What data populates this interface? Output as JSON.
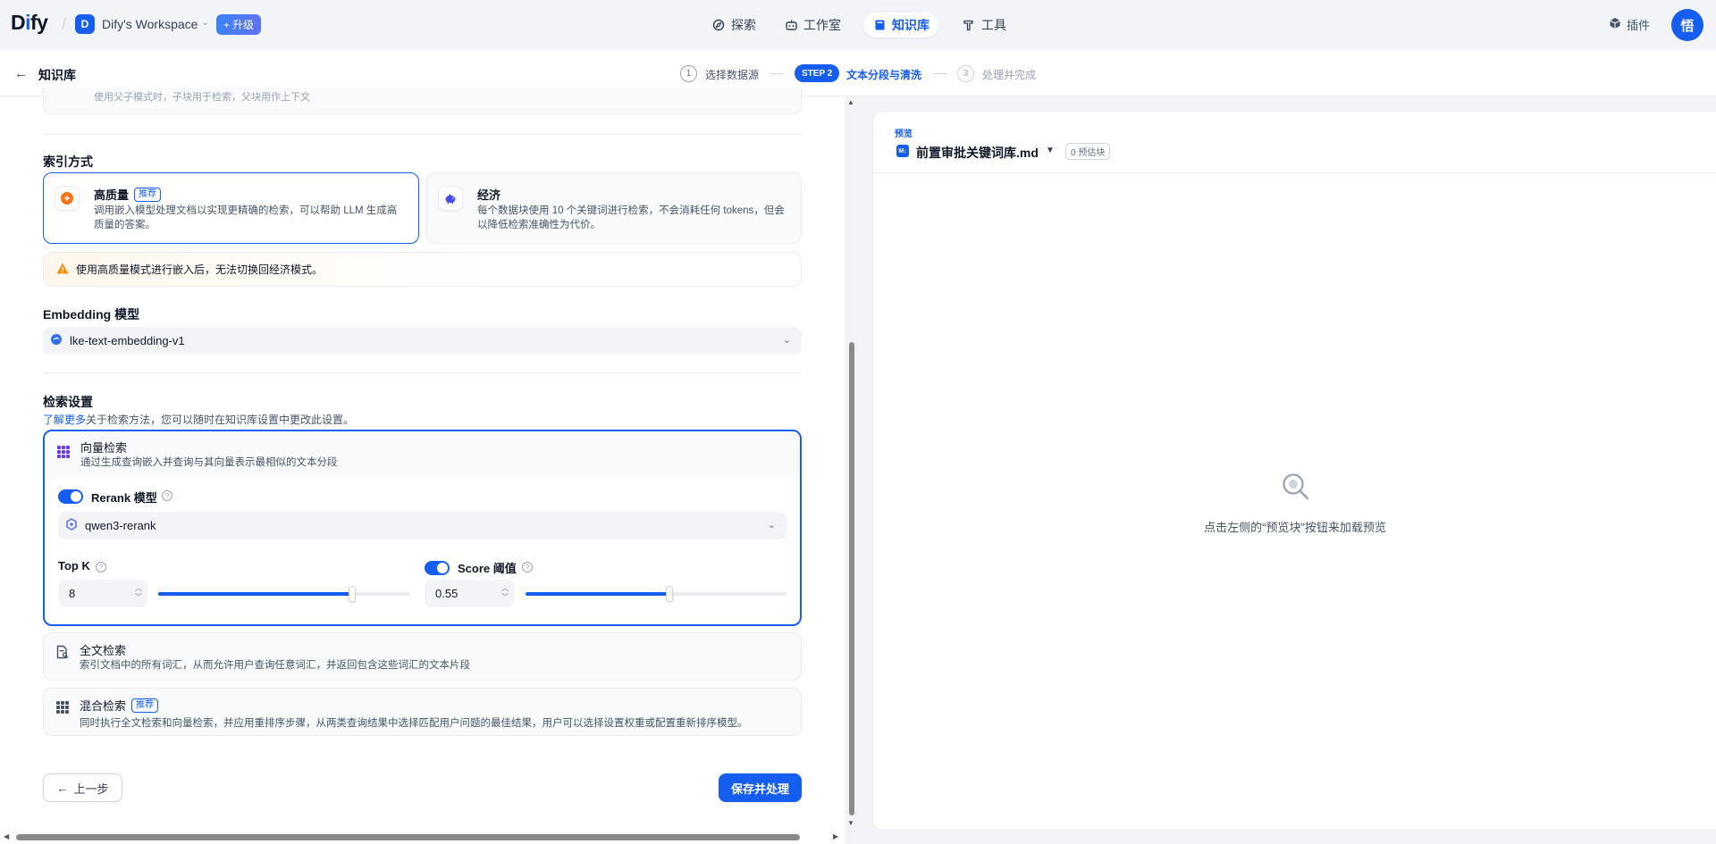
{
  "app": {
    "logo_pre": "D",
    "logo_accent": "i",
    "logo_post": "fy",
    "workspace_initial": "D",
    "workspace_name": "Dify's Workspace",
    "upgrade_label": "升级",
    "user_initial": "悟"
  },
  "nav": {
    "items": [
      {
        "label": "探索",
        "icon": "compass-icon"
      },
      {
        "label": "工作室",
        "icon": "robot-icon"
      },
      {
        "label": "知识库",
        "icon": "book-icon",
        "active": true
      },
      {
        "label": "工具",
        "icon": "hammer-icon"
      }
    ],
    "plugin_label": "插件"
  },
  "header": {
    "back_label": "知识库",
    "steps": [
      {
        "num": "1",
        "label": "选择数据源"
      },
      {
        "pill": "STEP 2",
        "label": "文本分段与清洗"
      },
      {
        "num": "3",
        "label": "处理并完成"
      }
    ]
  },
  "cut_card_text": "使用父子模式时，子块用于检索，父块用作上下文",
  "index": {
    "title": "索引方式",
    "high_quality": {
      "title": "高质量",
      "badge": "推荐",
      "desc": "调用嵌入模型处理文档以实现更精确的检索，可以帮助 LLM 生成高质量的答案。"
    },
    "economy": {
      "title": "经济",
      "desc": "每个数据块使用 10 个关键词进行检索，不会消耗任何 tokens，但会以降低检索准确性为代价。"
    },
    "warning": "使用高质量模式进行嵌入后，无法切换回经济模式。"
  },
  "embedding": {
    "title": "Embedding 模型",
    "model": "lke-text-embedding-v1"
  },
  "retrieval": {
    "title": "检索设置",
    "learn_more": "了解更多",
    "learn_rest": "关于检索方法，您可以随时在知识库设置中更改此设置。",
    "vector": {
      "title": "向量检索",
      "desc": "通过生成查询嵌入并查询与其向量表示最相似的文本分段",
      "rerank_label": "Rerank 模型",
      "rerank_enabled": true,
      "rerank_model": "qwen3-rerank",
      "top_k_label": "Top K",
      "top_k_value": "8",
      "top_k_level": 0.77,
      "score_label": "Score 阈值",
      "score_enabled": true,
      "score_value": "0.55",
      "score_level": 0.55
    },
    "fulltext": {
      "title": "全文检索",
      "desc": "索引文档中的所有词汇，从而允许用户查询任意词汇，并返回包含这些词汇的文本片段"
    },
    "hybrid": {
      "title": "混合检索",
      "badge": "推荐",
      "desc": "同时执行全文检索和向量检索，并应用重排序步骤，从两类查询结果中选择匹配用户问题的最佳结果，用户可以选择设置权重或配置重新排序模型。"
    }
  },
  "actions": {
    "prev_label": "上一步",
    "save_label": "保存并处理"
  },
  "preview": {
    "label": "预览",
    "file_badge": "M↓",
    "file_name": "前置审批关键词库.md",
    "chunk_count": "0 预估块",
    "empty_text": "点击左侧的“预览块”按钮来加载预览"
  },
  "colors": {
    "primary": "#155eef",
    "warning": "#f79009",
    "purple": "#6938ef"
  }
}
